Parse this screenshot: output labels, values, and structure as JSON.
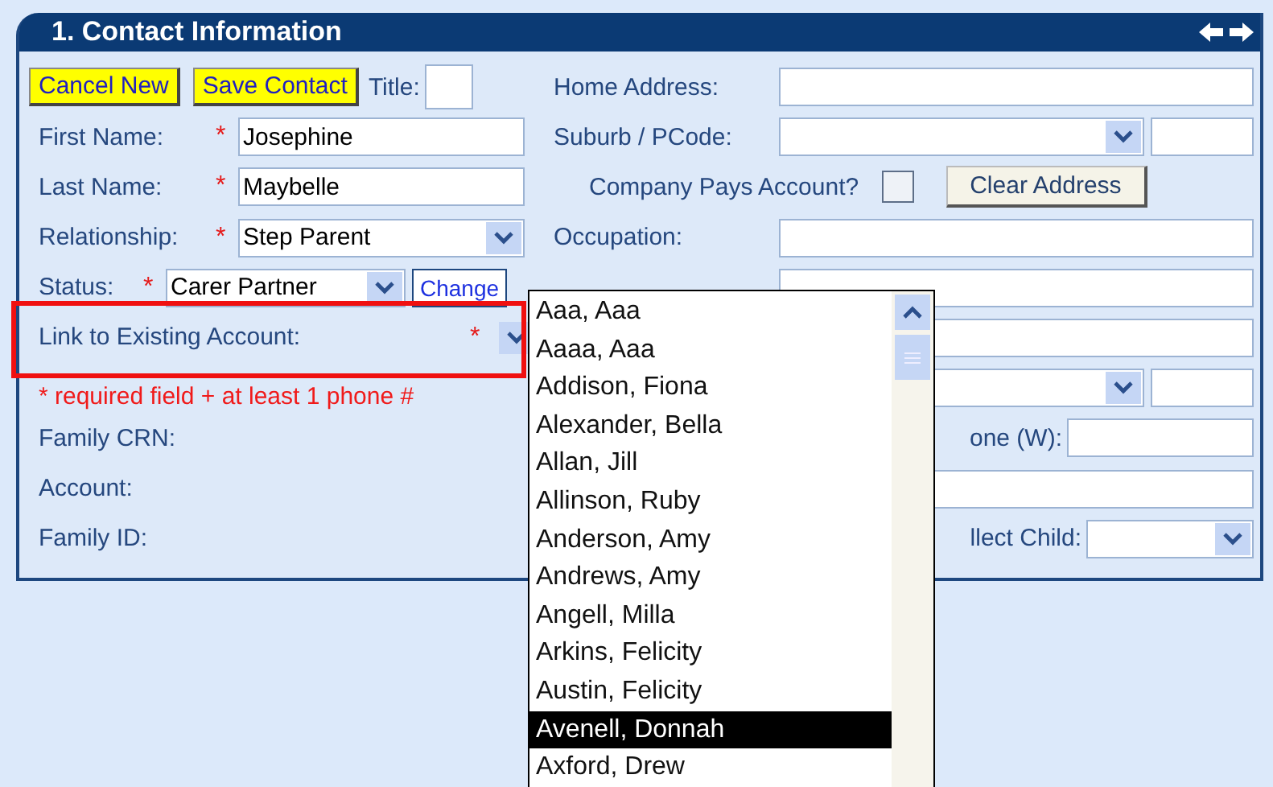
{
  "panel": {
    "title": "1. Contact Information"
  },
  "toolbar": {
    "buttons": [
      "Cancel New",
      "Save Contact"
    ],
    "title_label": "Title:"
  },
  "left_fields": [
    {
      "kind": "text",
      "label": "First Name:",
      "mark": "*",
      "value": "Josephine"
    },
    {
      "kind": "text",
      "label": "Last Name:",
      "mark": "*",
      "value": "Maybelle"
    },
    {
      "kind": "select",
      "label": "Relationship:",
      "mark": "*",
      "value": "Step Parent"
    },
    {
      "kind": "status",
      "label": "Status:",
      "mark": "*",
      "value": "Carer Partner",
      "action": "Change"
    },
    {
      "kind": "link",
      "label": "Link to Existing Account:",
      "mark": "*"
    },
    {
      "kind": "note",
      "label": "* required field + at least 1 phone #"
    },
    {
      "kind": "info",
      "label": "Family CRN:"
    },
    {
      "kind": "info",
      "label": "Account:"
    },
    {
      "kind": "info",
      "label": "Family ID:"
    }
  ],
  "right_fields": [
    {
      "kind": "text",
      "label": "Home Address:"
    },
    {
      "kind": "select_code",
      "label": "Suburb / PCode:"
    },
    {
      "kind": "checkbox",
      "label": "Company Pays Account?",
      "checked": false,
      "action": "Clear Address"
    },
    {
      "kind": "text",
      "label": "Occupation:"
    },
    {
      "kind": "text"
    },
    {
      "kind": "text"
    },
    {
      "kind": "select_code"
    },
    {
      "kind": "short",
      "label": "one (W):"
    },
    {
      "kind": "text"
    },
    {
      "kind": "short_select",
      "label": "llect Child:"
    }
  ],
  "dropdown": {
    "items": [
      {
        "label": "Aaa, Aaa",
        "selected": false
      },
      {
        "label": "Aaaa, Aaa",
        "selected": false
      },
      {
        "label": "Addison, Fiona",
        "selected": false
      },
      {
        "label": "Alexander, Bella",
        "selected": false
      },
      {
        "label": "Allan, Jill",
        "selected": false
      },
      {
        "label": "Allinson, Ruby",
        "selected": false
      },
      {
        "label": "Anderson, Amy",
        "selected": false
      },
      {
        "label": "Andrews, Amy",
        "selected": false
      },
      {
        "label": "Angell, Milla",
        "selected": false
      },
      {
        "label": "Arkins, Felicity",
        "selected": false
      },
      {
        "label": "Austin, Felicity",
        "selected": false
      },
      {
        "label": "Avenell, Donnah",
        "selected": true
      },
      {
        "label": "Axford, Drew",
        "selected": false
      }
    ]
  }
}
